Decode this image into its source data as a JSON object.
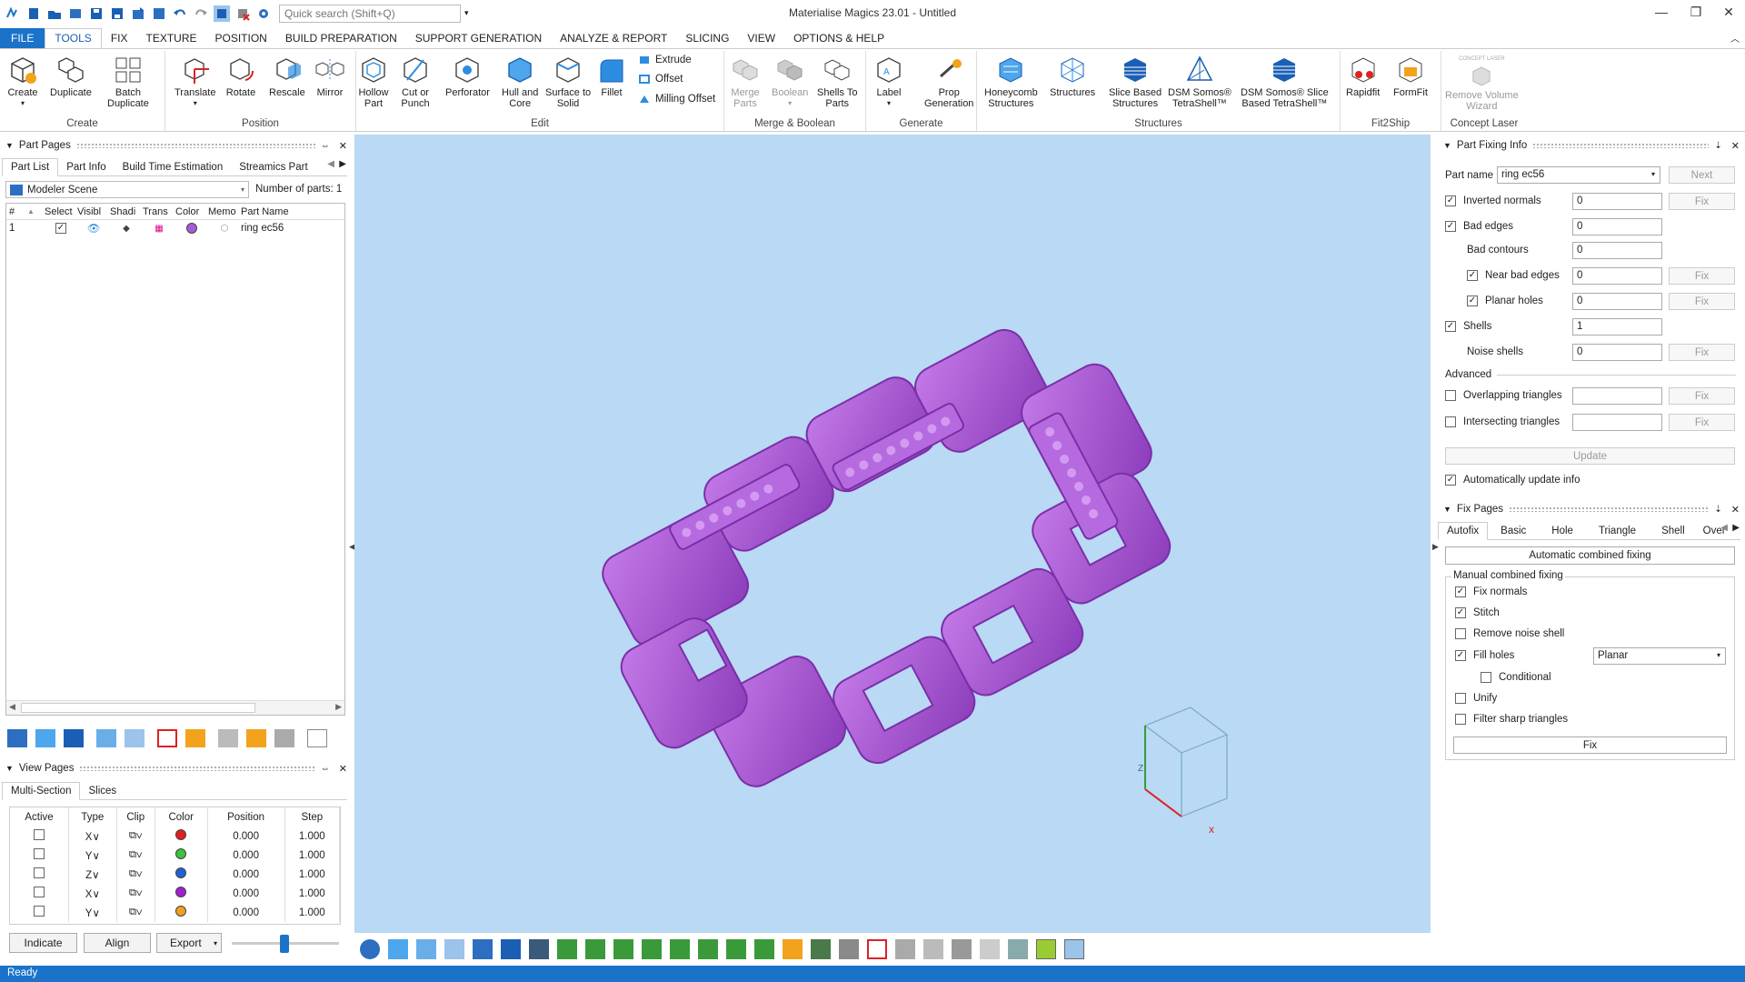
{
  "app": {
    "title": "Materialise Magics 23.01 - Untitled"
  },
  "search": {
    "placeholder": "Quick search (Shift+Q)"
  },
  "menu": {
    "tabs": [
      "FILE",
      "TOOLS",
      "FIX",
      "TEXTURE",
      "POSITION",
      "BUILD PREPARATION",
      "SUPPORT GENERATION",
      "ANALYZE & REPORT",
      "SLICING",
      "VIEW",
      "OPTIONS & HELP"
    ],
    "active": "TOOLS"
  },
  "ribbon": {
    "groups": [
      "Create",
      "Position",
      "Edit",
      "Merge & Boolean",
      "Generate",
      "Structures",
      "Fit2Ship",
      "Concept Laser"
    ],
    "create": {
      "create": "Create",
      "duplicate": "Duplicate",
      "batch1": "Batch",
      "batch2": "Duplicate"
    },
    "position": {
      "translate": "Translate",
      "rotate": "Rotate",
      "rescale": "Rescale",
      "mirror": "Mirror"
    },
    "edit": {
      "hollow1": "Hollow",
      "hollow2": "Part",
      "cut1": "Cut or",
      "cut2": "Punch",
      "perforator": "Perforator",
      "hull1": "Hull and",
      "hull2": "Core",
      "surf1": "Surface to",
      "surf2": "Solid",
      "fillet": "Fillet",
      "extrude": "Extrude",
      "offset": "Offset",
      "milling": "Milling Offset"
    },
    "merge": {
      "merge1": "Merge",
      "merge2": "Parts",
      "boolean": "Boolean",
      "shells1": "Shells To",
      "shells2": "Parts"
    },
    "generate": {
      "label": "Label",
      "prop1": "Prop",
      "prop2": "Generation"
    },
    "structures": {
      "honey1": "Honeycomb",
      "honey2": "Structures",
      "structures": "Structures",
      "slice1": "Slice Based",
      "slice2": "Structures",
      "dsm1": "DSM Somos®",
      "dsm2": "TetraShell™",
      "dsms1": "DSM Somos® Slice",
      "dsms2": "Based TetraShell™"
    },
    "fit2ship": {
      "rapidfit": "Rapidfit",
      "formfit": "FormFit"
    },
    "concept": {
      "small": "CONCEPT LASER",
      "rv1": "Remove Volume",
      "rv2": "Wizard"
    }
  },
  "partPages": {
    "title": "Part Pages",
    "tabs": [
      "Part List",
      "Part Info",
      "Build Time Estimation",
      "Streamics Part"
    ],
    "scene": "Modeler Scene",
    "numParts": "Number of parts: 1",
    "columns": [
      "#",
      "Select",
      "Visibl",
      "Shadi",
      "Trans",
      "Color",
      "Memo",
      "Part Name"
    ],
    "rows": [
      {
        "num": "1",
        "name": "ring ec56"
      }
    ]
  },
  "viewPages": {
    "title": "View Pages",
    "tabs": [
      "Multi-Section",
      "Slices"
    ],
    "columns": [
      "Active",
      "Type",
      "Clip",
      "Color",
      "Position",
      "Step"
    ],
    "rows": [
      {
        "type": "X∨",
        "color": "#e02020",
        "position": "0.000",
        "step": "1.000"
      },
      {
        "type": "Y∨",
        "color": "#40c040",
        "position": "0.000",
        "step": "1.000"
      },
      {
        "type": "Z∨",
        "color": "#2060d0",
        "position": "0.000",
        "step": "1.000"
      },
      {
        "type": "X∨",
        "color": "#a020d0",
        "position": "0.000",
        "step": "1.000"
      },
      {
        "type": "Y∨",
        "color": "#f0a020",
        "position": "0.000",
        "step": "1.000"
      }
    ],
    "buttons": {
      "indicate": "Indicate",
      "align": "Align",
      "export": "Export"
    }
  },
  "partFixing": {
    "title": "Part Fixing Info",
    "partNameLabel": "Part name",
    "partName": "ring ec56",
    "next": "Next",
    "fix": "Fix",
    "rows": [
      {
        "label": "Inverted normals",
        "value": "0"
      },
      {
        "label": "Bad edges",
        "value": "0"
      },
      {
        "label": "Bad contours",
        "value": "0"
      },
      {
        "label": "Near bad edges",
        "value": "0"
      },
      {
        "label": "Planar holes",
        "value": "0"
      },
      {
        "label": "Shells",
        "value": "1"
      },
      {
        "label": "Noise shells",
        "value": "0"
      }
    ],
    "advanced": "Advanced",
    "overlapping": "Overlapping triangles",
    "intersecting": "Intersecting triangles",
    "update": "Update",
    "autoUpdate": "Automatically update info"
  },
  "fixPages": {
    "title": "Fix Pages",
    "tabs": [
      "Autofix",
      "Basic",
      "Hole",
      "Triangle",
      "Shell",
      "Over"
    ],
    "automatic": "Automatic combined fixing",
    "manualTitle": "Manual combined fixing",
    "options": [
      "Fix normals",
      "Stitch",
      "Remove noise shell",
      "Fill holes",
      "Conditional",
      "Unify",
      "Filter sharp triangles"
    ],
    "fillMode": "Planar",
    "fix": "Fix"
  },
  "status": {
    "text": "Ready"
  },
  "colors": {
    "accent": "#1a73c9",
    "viewport": "#b9d9f4",
    "part": "#a95ad6"
  }
}
